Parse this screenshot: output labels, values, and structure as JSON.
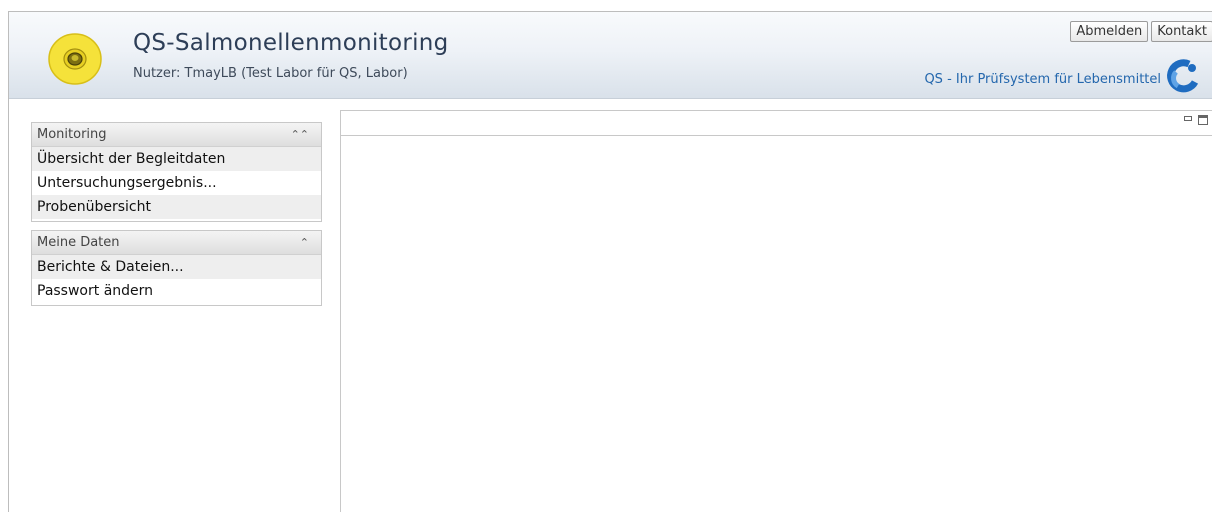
{
  "header": {
    "title": "QS-Salmonellenmonitoring",
    "user": "Nutzer: TmayLB (Test Labor für QS, Labor)",
    "tagline": "QS - Ihr Prüfsystem für Lebensmittel",
    "buttons": {
      "logout": "Abmelden",
      "contact": "Kontakt"
    }
  },
  "sidebar": {
    "panels": [
      {
        "title": "Monitoring",
        "items": [
          "Übersicht der Begleitdaten",
          "Untersuchungsergebnis...",
          "Probenübersicht"
        ]
      },
      {
        "title": "Meine Daten",
        "items": [
          "Berichte & Dateien...",
          "Passwort ändern"
        ]
      }
    ]
  },
  "icons": {
    "collapse": "double-chevron-up-icon",
    "app_logo": "yellow-eartag-logo",
    "brand_logo": "qs-swirl-logo"
  },
  "colors": {
    "title": "#2d3e57",
    "tagline": "#2467ad",
    "logo_yellow": "#f5e23a",
    "brand_blue": "#1f6cc0"
  }
}
